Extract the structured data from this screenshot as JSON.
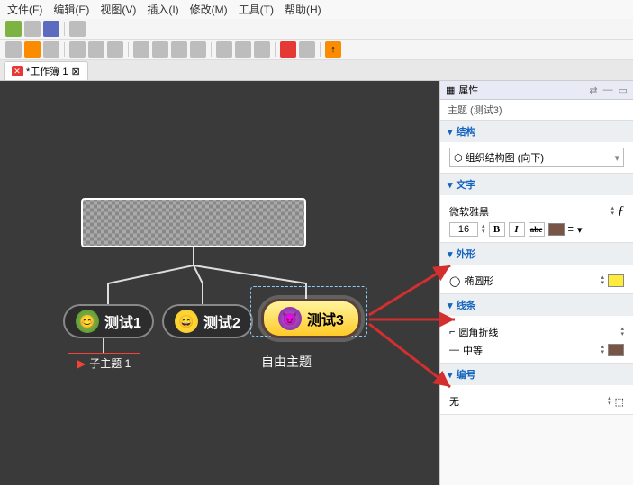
{
  "menu": {
    "file": "文件(F)",
    "edit": "编辑(E)",
    "view": "视图(V)",
    "insert": "插入(I)",
    "modify": "修改(M)",
    "tools": "工具(T)",
    "help": "帮助(H)"
  },
  "tab": {
    "title": "*工作簿 1",
    "marker": "⊠"
  },
  "nodes": {
    "c1": "测试1",
    "c2": "测试2",
    "c3": "测试3",
    "sub": "子主题 1",
    "free": "自由主题"
  },
  "panel": {
    "title": "属性",
    "subtitle": "主题 (测试3)",
    "structure": {
      "head": "结构",
      "value": "组织结构图 (向下)"
    },
    "text": {
      "head": "文字",
      "font": "微软雅黑",
      "size": "16"
    },
    "shape": {
      "head": "外形",
      "value": "椭圆形"
    },
    "line": {
      "head": "线条",
      "value1": "圆角折线",
      "value2": "中等"
    },
    "number": {
      "head": "编号",
      "value": "无"
    }
  }
}
